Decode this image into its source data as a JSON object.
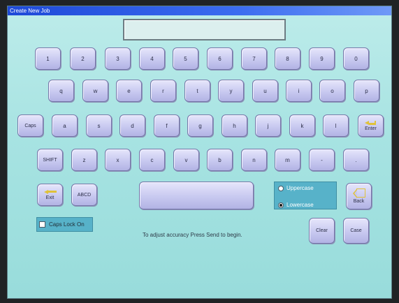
{
  "window": {
    "title": "Create New Job"
  },
  "display": {
    "value": ""
  },
  "keyboard": {
    "row_numbers": [
      "1",
      "2",
      "3",
      "4",
      "5",
      "6",
      "7",
      "8",
      "9",
      "0"
    ],
    "row_q": [
      "q",
      "w",
      "e",
      "r",
      "t",
      "y",
      "u",
      "i",
      "o",
      "p"
    ],
    "row_a": [
      "a",
      "s",
      "d",
      "f",
      "g",
      "h",
      "j",
      "k",
      "l"
    ],
    "row_z": [
      "z",
      "x",
      "c",
      "v",
      "b",
      "n",
      "m",
      "-",
      "."
    ],
    "caps_label": "Caps",
    "enter_label": "Enter",
    "shift_label": "SHIFT",
    "exit_label": "Exit",
    "abcd_label": "ABCD",
    "back_label": "Back",
    "clear_label": "Clear",
    "case_label": "Case"
  },
  "case_selector": {
    "uppercase_label": "Uppercase",
    "lowercase_label": "Lowercase",
    "selected": "Lowercase"
  },
  "caps_lock": {
    "label": "Caps Lock On",
    "checked": false
  },
  "hint": "To adjust accuracy Press Send to begin.",
  "colors": {
    "background": "#a7e3e2",
    "key": "#c8c9f0",
    "panel": "#57b2c9",
    "title_bar": "#1e49d8",
    "accent_arrow": "#e0c23a"
  },
  "icons": {
    "exit": "arrow-left-icon",
    "enter": "enter-icon",
    "back": "backspace-icon"
  }
}
